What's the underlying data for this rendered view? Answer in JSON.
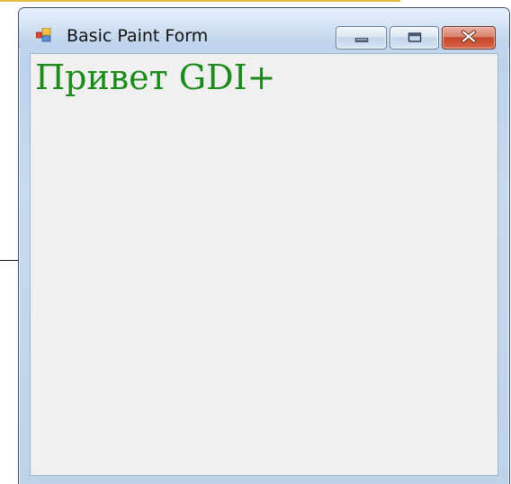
{
  "window": {
    "title": "Basic Paint Form",
    "icon": "app-form-icon",
    "buttons": {
      "minimize": "minimize-icon",
      "maximize": "maximize-icon",
      "close": "close-icon",
      "close_color": "#c4462b"
    }
  },
  "client": {
    "background": "#f0f0f0",
    "greeting_text": "Привет GDI+",
    "greeting_color": "#1a8a1a"
  }
}
